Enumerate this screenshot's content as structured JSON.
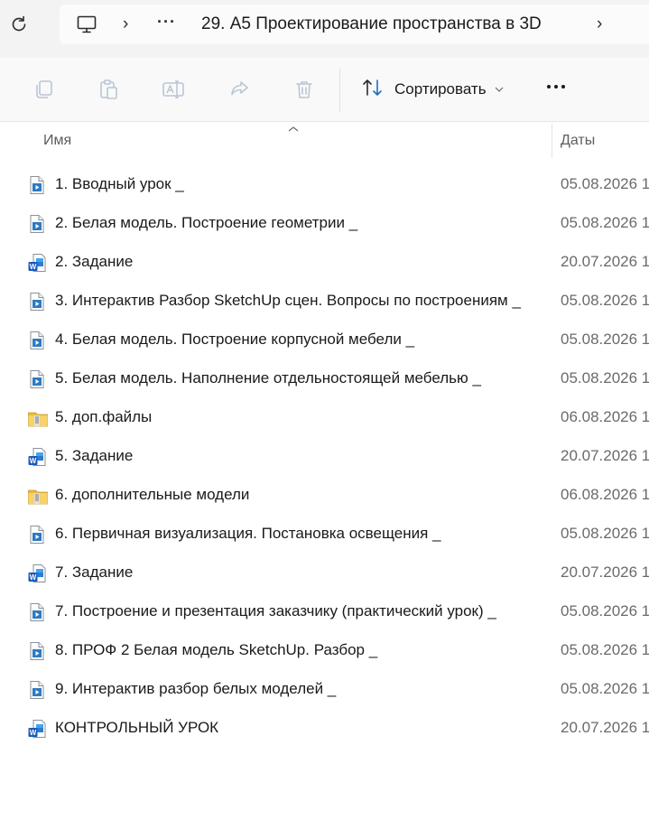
{
  "address_bar": {
    "ellipsis": "···",
    "path": "29. А5 Проектирование пространства в 3D"
  },
  "toolbar": {
    "sort_label": "Сортировать"
  },
  "columns": {
    "name": "Имя",
    "date": "Даты"
  },
  "files": [
    {
      "name": "1. Вводный урок _",
      "date": "05.08.2026 1",
      "type": "video"
    },
    {
      "name": "2. Белая модель. Построение геометрии _",
      "date": "05.08.2026 1",
      "type": "video"
    },
    {
      "name": "2. Задание",
      "date": "20.07.2026 1",
      "type": "word"
    },
    {
      "name": "3. Интерактив Разбор SketchUp сцен. Вопросы по построениям _",
      "date": "05.08.2026 1",
      "type": "video"
    },
    {
      "name": "4. Белая модель. Построение корпусной мебели _",
      "date": "05.08.2026 1",
      "type": "video"
    },
    {
      "name": "5. Белая модель. Наполнение отдельностоящей мебелью _",
      "date": "05.08.2026 1",
      "type": "video"
    },
    {
      "name": "5. доп.файлы",
      "date": "06.08.2026 1",
      "type": "zip"
    },
    {
      "name": "5. Задание",
      "date": "20.07.2026 1",
      "type": "word"
    },
    {
      "name": "6. дополнительные модели",
      "date": "06.08.2026 1",
      "type": "zip"
    },
    {
      "name": "6. Первичная визуализация. Постановка освещения _",
      "date": "05.08.2026 1",
      "type": "video"
    },
    {
      "name": "7. Задание",
      "date": "20.07.2026 1",
      "type": "word"
    },
    {
      "name": "7. Построение и презентация заказчику (практический урок) _",
      "date": "05.08.2026 1",
      "type": "video"
    },
    {
      "name": "8. ПРОФ 2 Белая модель SketchUp. Разбор _",
      "date": "05.08.2026 1",
      "type": "video"
    },
    {
      "name": "9. Интерактив разбор белых моделей _",
      "date": "05.08.2026 1",
      "type": "video"
    },
    {
      "name": "КОНТРОЛЬНЫЙ УРОК",
      "date": "20.07.2026 1",
      "type": "word"
    }
  ]
}
